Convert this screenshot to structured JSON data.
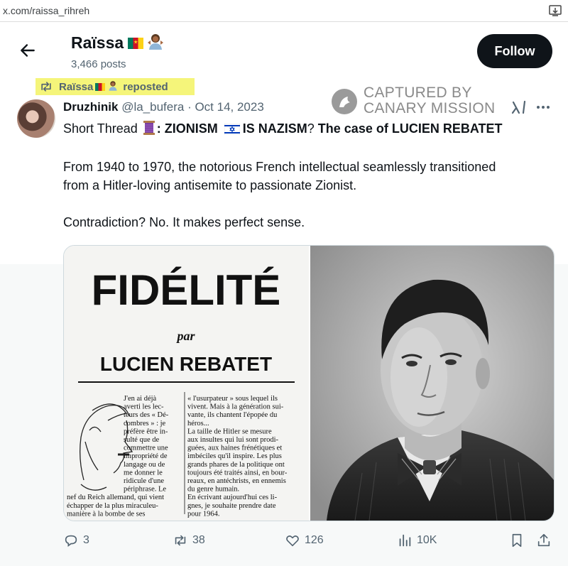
{
  "browser": {
    "url": "x.com/raissa_rihreh"
  },
  "header": {
    "name": "Raïssa",
    "post_count": "3,466 posts",
    "follow_label": "Follow"
  },
  "repost_banner": {
    "name": "Raïssa",
    "suffix": "reposted"
  },
  "tweet": {
    "author": "Druzhinik",
    "handle": "@la_bufera",
    "separator": " · ",
    "date": "Oct 14, 2023",
    "line1_prefix": "Short Thread",
    "line1_colon": ": ",
    "line1_bold_a": "ZIONISM",
    "line1_bold_b": "IS NAZISM",
    "line1_q": "? ",
    "line1_bold_c": "The case of LUCIEN REBATET",
    "paragraph2": "From 1940 to 1970, the notorious French intellectual seamlessly transitioned from a Hitler-loving antisemite to passionate Zionist.",
    "paragraph3": "Contradiction? No. It makes perfect sense."
  },
  "watermark": {
    "line1": "CAPTURED BY",
    "line2": "CANARY MISSION"
  },
  "newspaper": {
    "title": "FIDÉLITÉ",
    "by": "par",
    "author": "LUCIEN REBATET",
    "col1": [
      "J'en ai déjà",
      "averti les lec-",
      "teurs des « Dé-",
      "combres » : je",
      "préfère être in-",
      "sulté que de",
      "commettre une",
      "impropriété de",
      "langage ou de",
      "me donner le",
      "ridicule d'une",
      "périphrase. Le",
      "nef du Reich allemand, qui vient",
      "échapper de la plus miraculeu-",
      "manière à la bombe de ses"
    ],
    "col2": [
      "« l'usurpateur » sous lequel ils",
      "vivent. Mais à la génération sui-",
      "vante, ils chantent l'épopée du",
      "héros...",
      "La taille de Hitler se mesure",
      "aux insultes qui lui sont prodi-",
      "guées, aux haines frénétiques et",
      "imbéciles qu'il inspire. Les plus",
      "grands phares de la politique ont",
      "toujours été traités ainsi, en bour-",
      "reaux, en antéchrists, en ennemis",
      "du genre humain.",
      "En écrivant aujourd'hui ces li-",
      "gnes, je souhaite prendre date",
      "pour 1964."
    ]
  },
  "actions": {
    "replies": "3",
    "reposts": "38",
    "likes": "126",
    "views": "10K"
  },
  "icons": {
    "back": "arrow-left-icon",
    "download": "download-icon",
    "repost": "repost-icon",
    "grok": "grok-icon",
    "more": "more-icon",
    "reply": "reply-icon",
    "like": "heart-icon",
    "views": "views-icon",
    "bookmark": "bookmark-icon",
    "share": "share-icon"
  },
  "colors": {
    "follow_bg": "#0f1419",
    "highlight": "#f5f57a",
    "secondary_text": "#536471",
    "watermark": "#8a8a8a"
  }
}
